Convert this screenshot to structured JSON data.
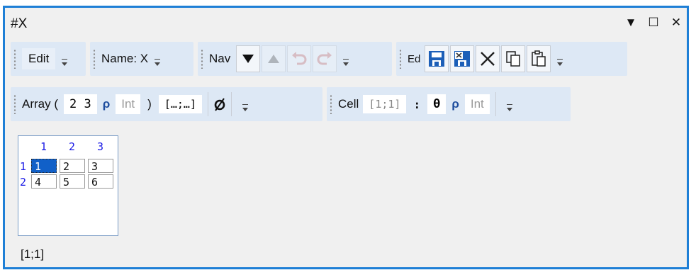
{
  "window": {
    "title": "#X"
  },
  "toolbar1": {
    "edit_label": "Edit",
    "name_label": "Name: X",
    "nav_label": "Nav",
    "ed_label": "Ed"
  },
  "toolbar2": {
    "array_label": "Array (",
    "shape_value": "2 3",
    "rho": "ρ",
    "type_value": "Int",
    "close_paren": ")",
    "index_template": "[…;…]",
    "cell_label": "Cell",
    "cell_index": "[1;1]",
    "colon": ":",
    "cell_value": "θ",
    "cell_type": "Int"
  },
  "grid": {
    "col_headers": [
      "1",
      "2",
      "3"
    ],
    "row_headers": [
      "1",
      "2"
    ],
    "rows": [
      [
        "1",
        "2",
        "3"
      ],
      [
        "4",
        "5",
        "6"
      ]
    ]
  },
  "status": {
    "text": "[1;1]"
  },
  "colors": {
    "accent": "#1e7fd6",
    "selection": "#1160c8",
    "save_icon": "#1c5fb8"
  }
}
